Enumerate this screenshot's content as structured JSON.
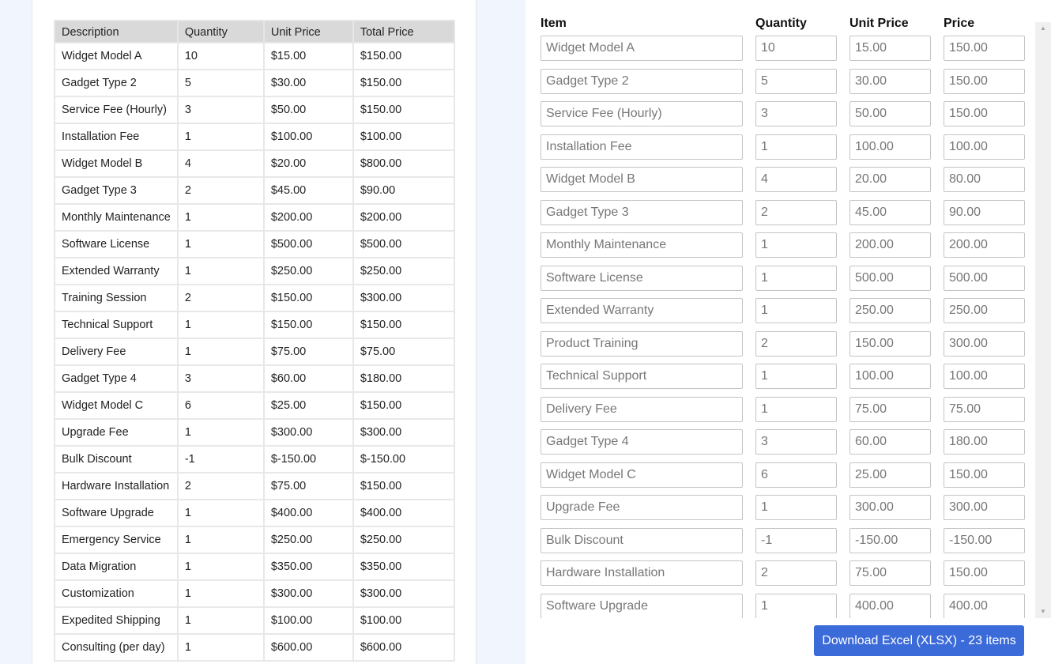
{
  "invoice_table": {
    "headers": [
      "Description",
      "Quantity",
      "Unit Price",
      "Total Price"
    ],
    "rows": [
      [
        "Widget Model A",
        "10",
        "$15.00",
        "$150.00"
      ],
      [
        "Gadget Type 2",
        "5",
        "$30.00",
        "$150.00"
      ],
      [
        "Service Fee (Hourly)",
        "3",
        "$50.00",
        "$150.00"
      ],
      [
        "Installation Fee",
        "1",
        "$100.00",
        "$100.00"
      ],
      [
        "Widget Model B",
        "4",
        "$20.00",
        "$800.00"
      ],
      [
        "Gadget Type 3",
        "2",
        "$45.00",
        "$90.00"
      ],
      [
        "Monthly Maintenance",
        "1",
        "$200.00",
        "$200.00"
      ],
      [
        "Software License",
        "1",
        "$500.00",
        "$500.00"
      ],
      [
        "Extended Warranty",
        "1",
        "$250.00",
        "$250.00"
      ],
      [
        "Training Session",
        "2",
        "$150.00",
        "$300.00"
      ],
      [
        "Technical Support",
        "1",
        "$150.00",
        "$150.00"
      ],
      [
        "Delivery Fee",
        "1",
        "$75.00",
        "$75.00"
      ],
      [
        "Gadget Type 4",
        "3",
        "$60.00",
        "$180.00"
      ],
      [
        "Widget Model C",
        "6",
        "$25.00",
        "$150.00"
      ],
      [
        "Upgrade Fee",
        "1",
        "$300.00",
        "$300.00"
      ],
      [
        "Bulk Discount",
        "-1",
        "$-150.00",
        "$-150.00"
      ],
      [
        "Hardware Installation",
        "2",
        "$75.00",
        "$150.00"
      ],
      [
        "Software Upgrade",
        "1",
        "$400.00",
        "$400.00"
      ],
      [
        "Emergency Service",
        "1",
        "$250.00",
        "$250.00"
      ],
      [
        "Data Migration",
        "1",
        "$350.00",
        "$350.00"
      ],
      [
        "Customization",
        "1",
        "$300.00",
        "$300.00"
      ],
      [
        "Expedited Shipping",
        "1",
        "$100.00",
        "$100.00"
      ],
      [
        "Consulting (per day)",
        "1",
        "$600.00",
        "$600.00"
      ]
    ]
  },
  "editor": {
    "headers": {
      "item": "Item",
      "quantity": "Quantity",
      "unit_price": "Unit Price",
      "price": "Price"
    },
    "rows": [
      {
        "item": "Widget Model A",
        "quantity": "10",
        "unit_price": "15.00",
        "price": "150.00"
      },
      {
        "item": "Gadget Type 2",
        "quantity": "5",
        "unit_price": "30.00",
        "price": "150.00"
      },
      {
        "item": "Service Fee (Hourly)",
        "quantity": "3",
        "unit_price": "50.00",
        "price": "150.00"
      },
      {
        "item": "Installation Fee",
        "quantity": "1",
        "unit_price": "100.00",
        "price": "100.00"
      },
      {
        "item": "Widget Model B",
        "quantity": "4",
        "unit_price": "20.00",
        "price": "80.00"
      },
      {
        "item": "Gadget Type 3",
        "quantity": "2",
        "unit_price": "45.00",
        "price": "90.00"
      },
      {
        "item": "Monthly Maintenance",
        "quantity": "1",
        "unit_price": "200.00",
        "price": "200.00"
      },
      {
        "item": "Software License",
        "quantity": "1",
        "unit_price": "500.00",
        "price": "500.00"
      },
      {
        "item": "Extended Warranty",
        "quantity": "1",
        "unit_price": "250.00",
        "price": "250.00"
      },
      {
        "item": "Product Training",
        "quantity": "2",
        "unit_price": "150.00",
        "price": "300.00"
      },
      {
        "item": "Technical Support",
        "quantity": "1",
        "unit_price": "100.00",
        "price": "100.00"
      },
      {
        "item": "Delivery Fee",
        "quantity": "1",
        "unit_price": "75.00",
        "price": "75.00"
      },
      {
        "item": "Gadget Type 4",
        "quantity": "3",
        "unit_price": "60.00",
        "price": "180.00"
      },
      {
        "item": "Widget Model C",
        "quantity": "6",
        "unit_price": "25.00",
        "price": "150.00"
      },
      {
        "item": "Upgrade Fee",
        "quantity": "1",
        "unit_price": "300.00",
        "price": "300.00"
      },
      {
        "item": "Bulk Discount",
        "quantity": "-1",
        "unit_price": "-150.00",
        "price": "-150.00"
      },
      {
        "item": "Hardware Installation",
        "quantity": "2",
        "unit_price": "75.00",
        "price": "150.00"
      },
      {
        "item": "Software Upgrade",
        "quantity": "1",
        "unit_price": "400.00",
        "price": "400.00"
      }
    ],
    "scrollbar": {
      "up_icon": "▲",
      "down_icon": "▼"
    },
    "download_button": {
      "label": "Download Excel (XLSX) - 23 items",
      "color": "#3b6ad9"
    }
  }
}
